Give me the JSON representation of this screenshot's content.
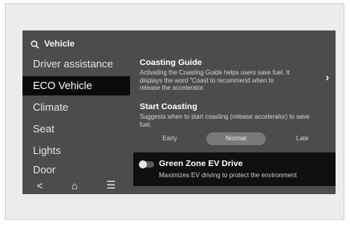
{
  "search": {
    "label": "Vehicle"
  },
  "sidebar": {
    "items": [
      {
        "label": "Driver assistance"
      },
      {
        "label": "ECO Vehicle"
      },
      {
        "label": "Climate"
      },
      {
        "label": "Seat"
      },
      {
        "label": "Lights"
      },
      {
        "label": "Door"
      }
    ]
  },
  "bottom_bar": {
    "back": "<",
    "home": "⌂",
    "menu": "☰"
  },
  "coasting_guide": {
    "title": "Coasting Guide",
    "desc_line1": "Activating the Coasting Guide helps users save fuel. It",
    "desc_line2": "displays the word \"Coast to recommend when to",
    "desc_line3": "release the accelerator."
  },
  "start_coasting": {
    "title": "Start Coasting",
    "desc_line1": "Suggests when to start coasting (release accelerator) to save",
    "desc_line2": "fuel.",
    "options": [
      "Early",
      "Normal",
      "Late"
    ],
    "selected": "Normal"
  },
  "green_zone": {
    "title": "Green Zone EV Drive",
    "desc": "Maximizes EV driving to protect the environment",
    "enabled": false
  },
  "colors": {
    "screen_bg": "#4c4c4c",
    "active_item_bg": "#0b0b0b",
    "selected_option_bg": "#787878"
  },
  "icons": [
    "search-icon",
    "back-icon",
    "home-icon",
    "menu-icon",
    "chevron-right-icon"
  ]
}
